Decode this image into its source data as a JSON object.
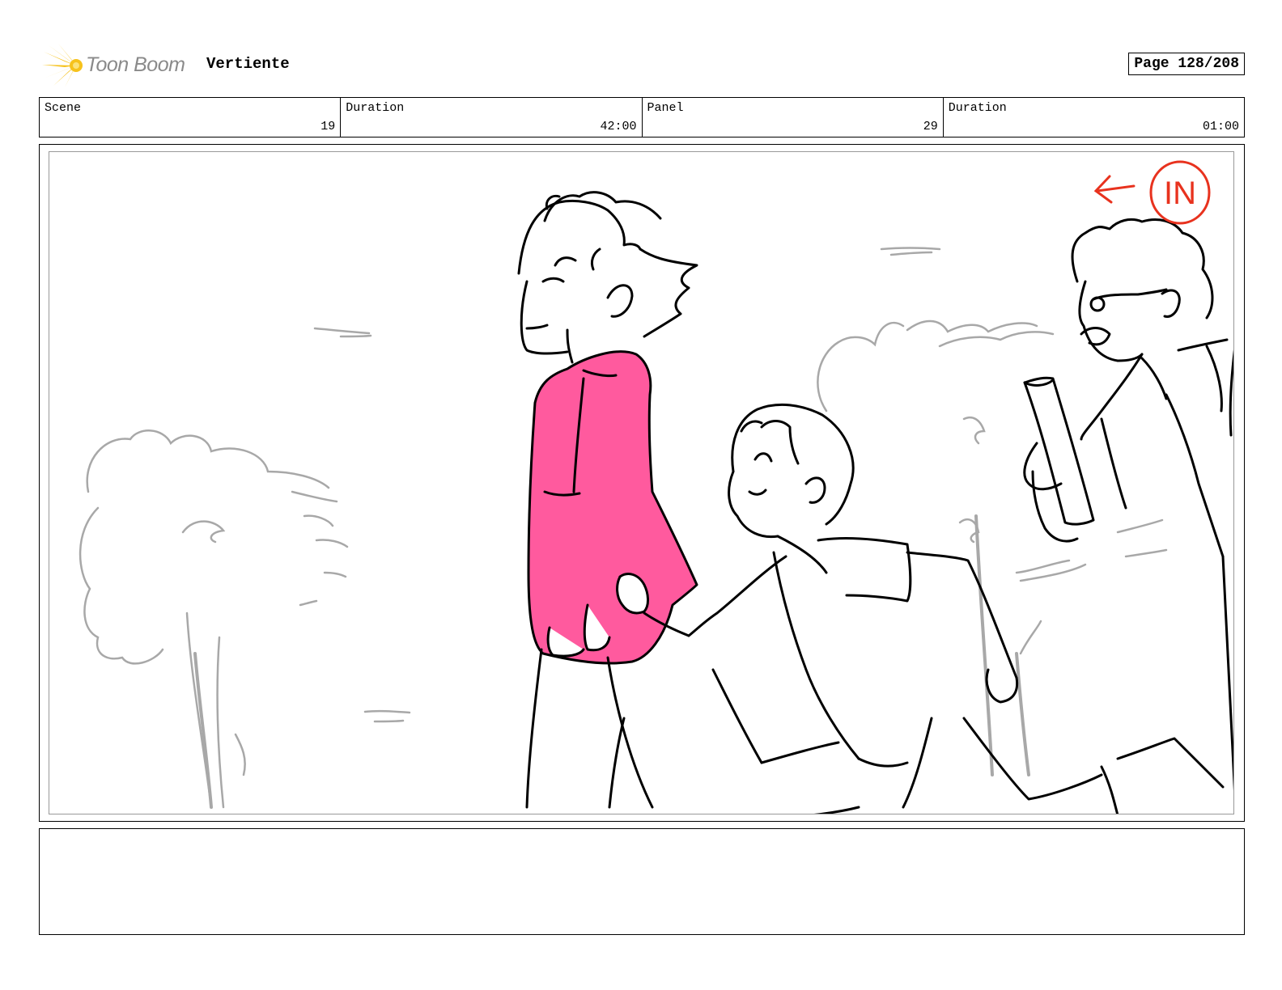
{
  "header": {
    "logo_text": "Toon Boom",
    "project_title": "Vertiente",
    "page_label": "Page 128/208"
  },
  "info": {
    "scene_label": "Scene",
    "scene_value": "19",
    "scene_duration_label": "Duration",
    "scene_duration_value": "42:00",
    "panel_label": "Panel",
    "panel_value": "29",
    "panel_duration_label": "Duration",
    "panel_duration_value": "01:00"
  },
  "panel": {
    "annotation_text": "IN",
    "annotation_color": "#e8321e",
    "shirt_color": "#ff5a9e",
    "logo_color": "#f6c21c"
  },
  "notes": {
    "text": ""
  }
}
